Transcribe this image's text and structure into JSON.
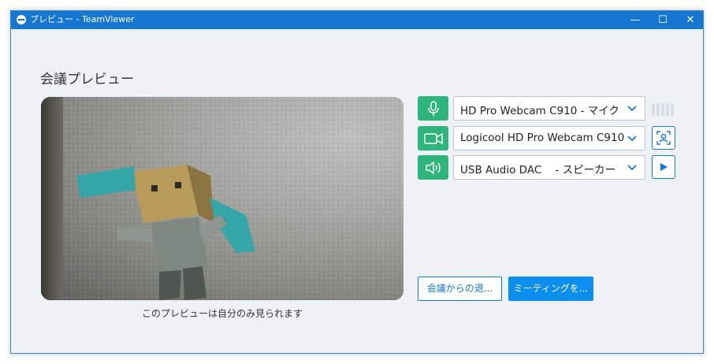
{
  "window": {
    "title": "プレビュー - TeamViewer",
    "minimize_glyph": "—",
    "maximize_glyph": "☐",
    "close_glyph": "✕"
  },
  "heading": "会議プレビュー",
  "preview": {
    "caption": "このプレビューは自分のみ見られます"
  },
  "devices": {
    "microphone": {
      "icon": "microphone-icon",
      "selected": "HD Pro Webcam C910 - マイク"
    },
    "camera": {
      "icon": "camera-icon",
      "selected": "Logicool HD Pro Webcam C910"
    },
    "speaker": {
      "icon": "speaker-icon",
      "selected": "USB Audio DAC    - スピーカー"
    }
  },
  "buttons": {
    "leave": "会議からの退...",
    "meeting": "ミーティングを..."
  },
  "colors": {
    "titlebar": "#1677d3",
    "device_icon_bg": "#2db57c",
    "accent": "#1677d3",
    "primary_button": "#0a8ff0"
  }
}
